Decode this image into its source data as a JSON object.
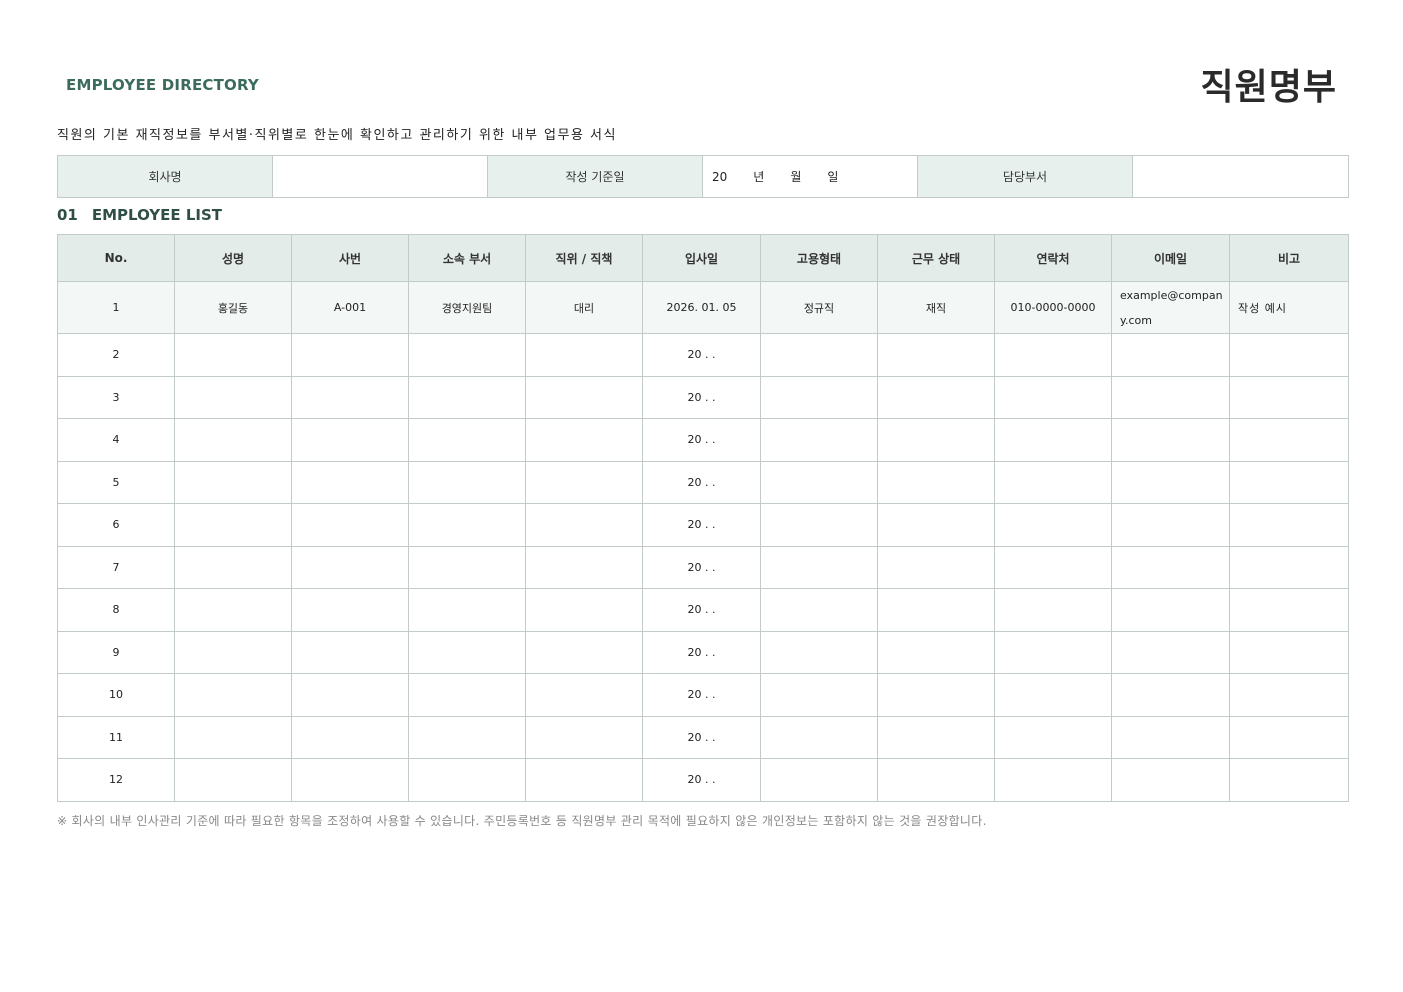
{
  "header": {
    "eyebrow": "EMPLOYEE DIRECTORY",
    "title": "직원명부",
    "description": "직원의 기본 재직정보를 부서별·직위별로 한눈에 확인하고 관리하기 위한 내부 업무용 서식"
  },
  "info": {
    "company_label": "회사명",
    "company_value": "",
    "date_label": "작성 기준일",
    "date_year": "20",
    "date_year_unit": "년",
    "date_month_unit": "월",
    "date_day_unit": "일",
    "dept_label": "담당부서",
    "dept_value": ""
  },
  "section": {
    "number": "01",
    "title": "EMPLOYEE LIST"
  },
  "table": {
    "headers": [
      "No.",
      "성명",
      "사번",
      "소속 부서",
      "직위 / 직책",
      "입사일",
      "고용형태",
      "근무 상태",
      "연락처",
      "이메일",
      "비고"
    ],
    "example_row": [
      "1",
      "홍길동",
      "A-001",
      "경영지원팀",
      "대리",
      "2026. 01. 05",
      "정규직",
      "재직",
      "010-0000-0000",
      "example@company.com",
      "작성 예시"
    ],
    "date_placeholder": "20 . .",
    "blank_rows": [
      "2",
      "3",
      "4",
      "5",
      "6",
      "7",
      "8",
      "9",
      "10",
      "11",
      "12"
    ]
  },
  "footnote": "※ 회사의 내부 인사관리 기준에 따라 필요한 항목을 조정하여 사용할 수 있습니다. 주민등록번호 등 직원명부 관리 목적에 필요하지 않은 개인정보는 포함하지 않는 것을 권장합니다."
}
